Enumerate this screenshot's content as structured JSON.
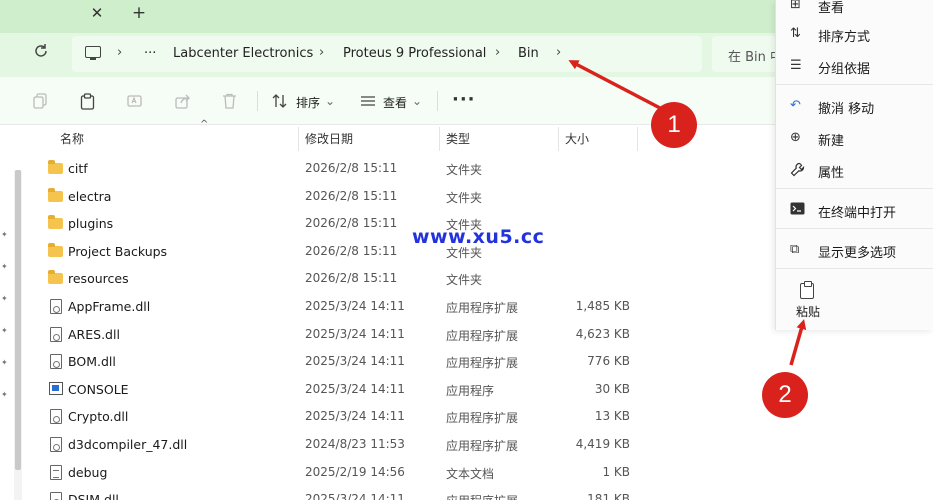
{
  "tabbar": {
    "close_glyph": "✕",
    "new_tab_glyph": "+"
  },
  "address": {
    "more_glyph": "···",
    "crumbs": [
      "Labcenter Electronics",
      "Proteus 9 Professional",
      "Bin"
    ],
    "search_placeholder": "在 Bin 中"
  },
  "toolbar": {
    "sort_label": "排序",
    "view_label": "查看",
    "more_glyph": "···"
  },
  "columns": {
    "name": "名称",
    "date": "修改日期",
    "type": "类型",
    "size": "大小"
  },
  "files": [
    {
      "name": "citf",
      "date": "2026/2/8 15:11",
      "type": "文件夹",
      "size": "",
      "icon": "folder-icon"
    },
    {
      "name": "electra",
      "date": "2026/2/8 15:11",
      "type": "文件夹",
      "size": "",
      "icon": "folder-icon"
    },
    {
      "name": "plugins",
      "date": "2026/2/8 15:11",
      "type": "文件夹",
      "size": "",
      "icon": "folder-icon"
    },
    {
      "name": "Project Backups",
      "date": "2026/2/8 15:11",
      "type": "文件夹",
      "size": "",
      "icon": "folder-icon"
    },
    {
      "name": "resources",
      "date": "2026/2/8 15:11",
      "type": "文件夹",
      "size": "",
      "icon": "folder-icon"
    },
    {
      "name": "AppFrame.dll",
      "date": "2025/3/24 14:11",
      "type": "应用程序扩展",
      "size": "1,485 KB",
      "icon": "dll-file-icon"
    },
    {
      "name": "ARES.dll",
      "date": "2025/3/24 14:11",
      "type": "应用程序扩展",
      "size": "4,623 KB",
      "icon": "dll-file-icon"
    },
    {
      "name": "BOM.dll",
      "date": "2025/3/24 14:11",
      "type": "应用程序扩展",
      "size": "776 KB",
      "icon": "dll-file-icon"
    },
    {
      "name": "CONSOLE",
      "date": "2025/3/24 14:11",
      "type": "应用程序",
      "size": "30 KB",
      "icon": "exe-file-icon"
    },
    {
      "name": "Crypto.dll",
      "date": "2025/3/24 14:11",
      "type": "应用程序扩展",
      "size": "13 KB",
      "icon": "dll-file-icon"
    },
    {
      "name": "d3dcompiler_47.dll",
      "date": "2024/8/23 11:53",
      "type": "应用程序扩展",
      "size": "4,419 KB",
      "icon": "dll-file-icon"
    },
    {
      "name": "debug",
      "date": "2025/2/19 14:56",
      "type": "文本文档",
      "size": "1 KB",
      "icon": "text-file-icon"
    },
    {
      "name": "DSIM.dll",
      "date": "2025/3/24 14:11",
      "type": "应用程序扩展",
      "size": "181 KB",
      "icon": "dll-file-icon"
    }
  ],
  "context_menu": {
    "items": [
      {
        "label": "查看",
        "icon": "view-icon",
        "glyph": "⊞"
      },
      {
        "label": "排序方式",
        "icon": "sort-icon",
        "glyph": "⇅"
      },
      {
        "label": "分组依据",
        "icon": "group-icon",
        "glyph": "☰"
      },
      {
        "label": "撤消 移动",
        "icon": "undo-icon",
        "glyph": "↶"
      },
      {
        "label": "新建",
        "icon": "new-icon",
        "glyph": "⊕"
      },
      {
        "label": "属性",
        "icon": "wrench-icon",
        "glyph": "🔧"
      },
      {
        "label": "在终端中打开",
        "icon": "terminal-icon",
        "glyph": "▣"
      },
      {
        "label": "显示更多选项",
        "icon": "more-options-icon",
        "glyph": "⧉"
      }
    ],
    "paste_label": "粘贴"
  },
  "watermark": "www.xu5.cc",
  "annotations": {
    "badge1": "1",
    "badge2": "2",
    "color": "#d9221c"
  }
}
